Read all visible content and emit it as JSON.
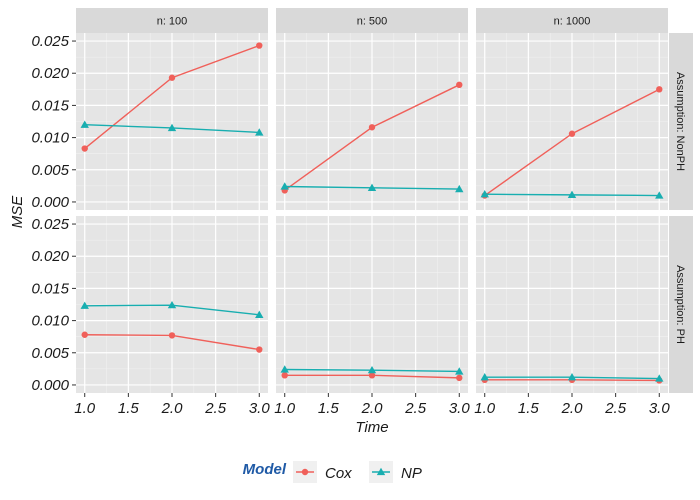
{
  "chart_data": {
    "type": "line",
    "title": "",
    "xlabel": "Time",
    "ylabel": "MSE",
    "xlim": [
      1.0,
      3.0
    ],
    "ylim": [
      0.0,
      0.025
    ],
    "x_ticks": [
      "1.0",
      "1.5",
      "2.0",
      "2.5",
      "3.0"
    ],
    "x_tick_values": [
      1.0,
      1.5,
      2.0,
      2.5,
      3.0
    ],
    "y_ticks": [
      "0.000",
      "0.005",
      "0.010",
      "0.015",
      "0.020",
      "0.025"
    ],
    "y_tick_values": [
      0.0,
      0.005,
      0.01,
      0.015,
      0.02,
      0.025
    ],
    "grid": true,
    "facet_cols": [
      "n: 100",
      "n: 500",
      "n: 1000"
    ],
    "facet_rows": [
      "Assumption: NonPH",
      "Assumption: PH"
    ],
    "legend": {
      "title": "Model",
      "title_color": "#1f5aa6",
      "placement": "bottom",
      "entries": [
        {
          "name": "Cox",
          "color": "#f0605a",
          "marker": "circle"
        },
        {
          "name": "NP",
          "color": "#18aeb0",
          "marker": "triangle"
        }
      ]
    },
    "x": [
      1.0,
      2.0,
      3.0
    ],
    "panels": [
      {
        "row": "Assumption: NonPH",
        "col": "n: 100",
        "series": [
          {
            "name": "Cox",
            "values": [
              0.0083,
              0.0193,
              0.0243
            ]
          },
          {
            "name": "NP",
            "values": [
              0.012,
              0.0115,
              0.0108
            ]
          }
        ]
      },
      {
        "row": "Assumption: NonPH",
        "col": "n: 500",
        "series": [
          {
            "name": "Cox",
            "values": [
              0.0018,
              0.0116,
              0.0182
            ]
          },
          {
            "name": "NP",
            "values": [
              0.0024,
              0.0022,
              0.002
            ]
          }
        ]
      },
      {
        "row": "Assumption: NonPH",
        "col": "n: 1000",
        "series": [
          {
            "name": "Cox",
            "values": [
              0.001,
              0.0106,
              0.0175
            ]
          },
          {
            "name": "NP",
            "values": [
              0.0012,
              0.0011,
              0.001
            ]
          }
        ]
      },
      {
        "row": "Assumption: PH",
        "col": "n: 100",
        "series": [
          {
            "name": "Cox",
            "values": [
              0.0078,
              0.0077,
              0.0055
            ]
          },
          {
            "name": "NP",
            "values": [
              0.0123,
              0.0124,
              0.0109
            ]
          }
        ]
      },
      {
        "row": "Assumption: PH",
        "col": "n: 500",
        "series": [
          {
            "name": "Cox",
            "values": [
              0.0015,
              0.0015,
              0.0011
            ]
          },
          {
            "name": "NP",
            "values": [
              0.0024,
              0.0023,
              0.0021
            ]
          }
        ]
      },
      {
        "row": "Assumption: PH",
        "col": "n: 1000",
        "series": [
          {
            "name": "Cox",
            "values": [
              0.0008,
              0.0008,
              0.0007
            ]
          },
          {
            "name": "NP",
            "values": [
              0.0012,
              0.0012,
              0.001
            ]
          }
        ]
      }
    ]
  }
}
